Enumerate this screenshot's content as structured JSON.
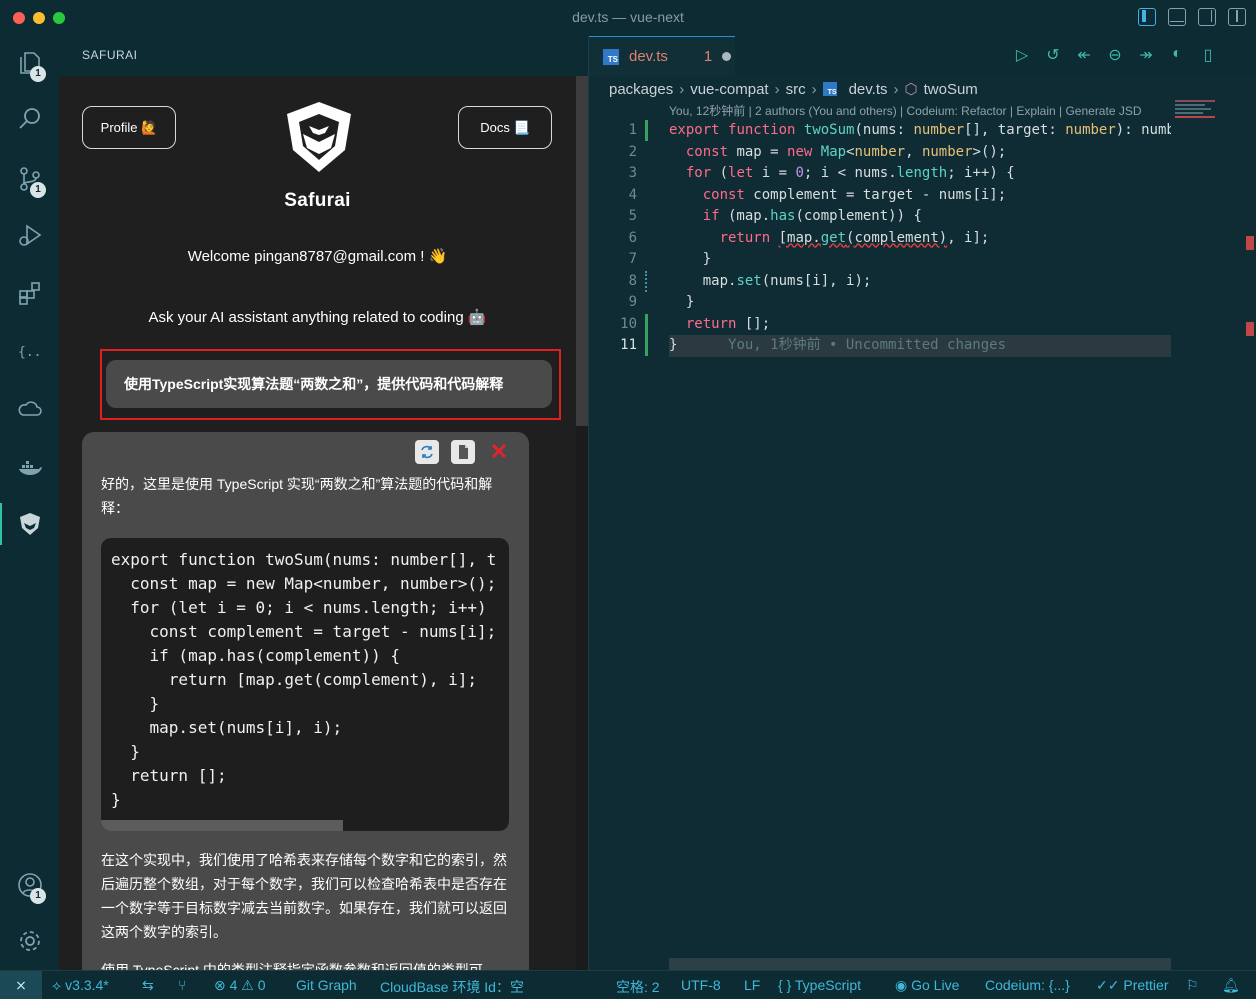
{
  "window": {
    "title": "dev.ts — vue-next"
  },
  "activity_bar": {
    "explorer_badge": "1",
    "scm_badge": "1",
    "accounts_badge": "1"
  },
  "sidebar": {
    "title": "SAFURAI",
    "profile_button": "Profile 🙋",
    "docs_button": "Docs 📃",
    "brand_name": "Safurai",
    "welcome": "Welcome pingan8787@gmail.com ! 👋",
    "ask": "Ask your AI assistant anything related to coding 🤖",
    "query": "使用TypeScript实现算法题“两数之和”，提供代码和代码解释",
    "answer": {
      "intro": "好的，这里是使用 TypeScript 实现“两数之和”算法题的代码和解释：",
      "code": "export function twoSum(nums: number[], t\n  const map = new Map<number, number>();\n  for (let i = 0; i < nums.length; i++) \n    const complement = target - nums[i];\n    if (map.has(complement)) {\n      return [map.get(complement), i];\n    }\n    map.set(nums[i], i);\n  }\n  return [];\n}",
      "explanation": "在这个实现中，我们使用了哈希表来存储每个数字和它的索引，然后遍历整个数组，对于每个数字，我们可以检查哈希表中是否存在一个数字等于目标数字减去当前数字。如果存在，我们就可以返回这两个数字的索引。",
      "more": "使用 TypeScript 中的类型注释指定函数参数和返回值的类型可"
    }
  },
  "editor": {
    "tab": {
      "name": "dev.ts",
      "problems": "1",
      "ts_badge": "TS"
    },
    "breadcrumb": [
      "packages",
      "vue-compat",
      "src",
      "dev.ts",
      "twoSum"
    ],
    "codelens": "You, 12秒钟前 | 2 authors (You and others) | Codeium: Refactor | Explain | Generate JSD",
    "line_numbers": [
      "1",
      "2",
      "3",
      "4",
      "5",
      "6",
      "7",
      "8",
      "9",
      "10",
      "11"
    ],
    "current_line": 11,
    "ghost_text": "You, 1秒钟前 • Uncommitted changes"
  },
  "status_bar": {
    "version": "v3.3.4*",
    "errors": "4",
    "warnings": "0",
    "git_graph": "Git Graph",
    "cloudbase": "CloudBase 环境 Id：空",
    "spaces": "空格: 2",
    "encoding": "UTF-8",
    "eol": "LF",
    "language": "TypeScript",
    "golive": "Go Live",
    "codeium": "Codeium: {...}",
    "prettier": "Prettier"
  },
  "colors": {
    "accent": "#2fc3a8",
    "error": "#e02020",
    "keyword": "#ff6b8a"
  }
}
